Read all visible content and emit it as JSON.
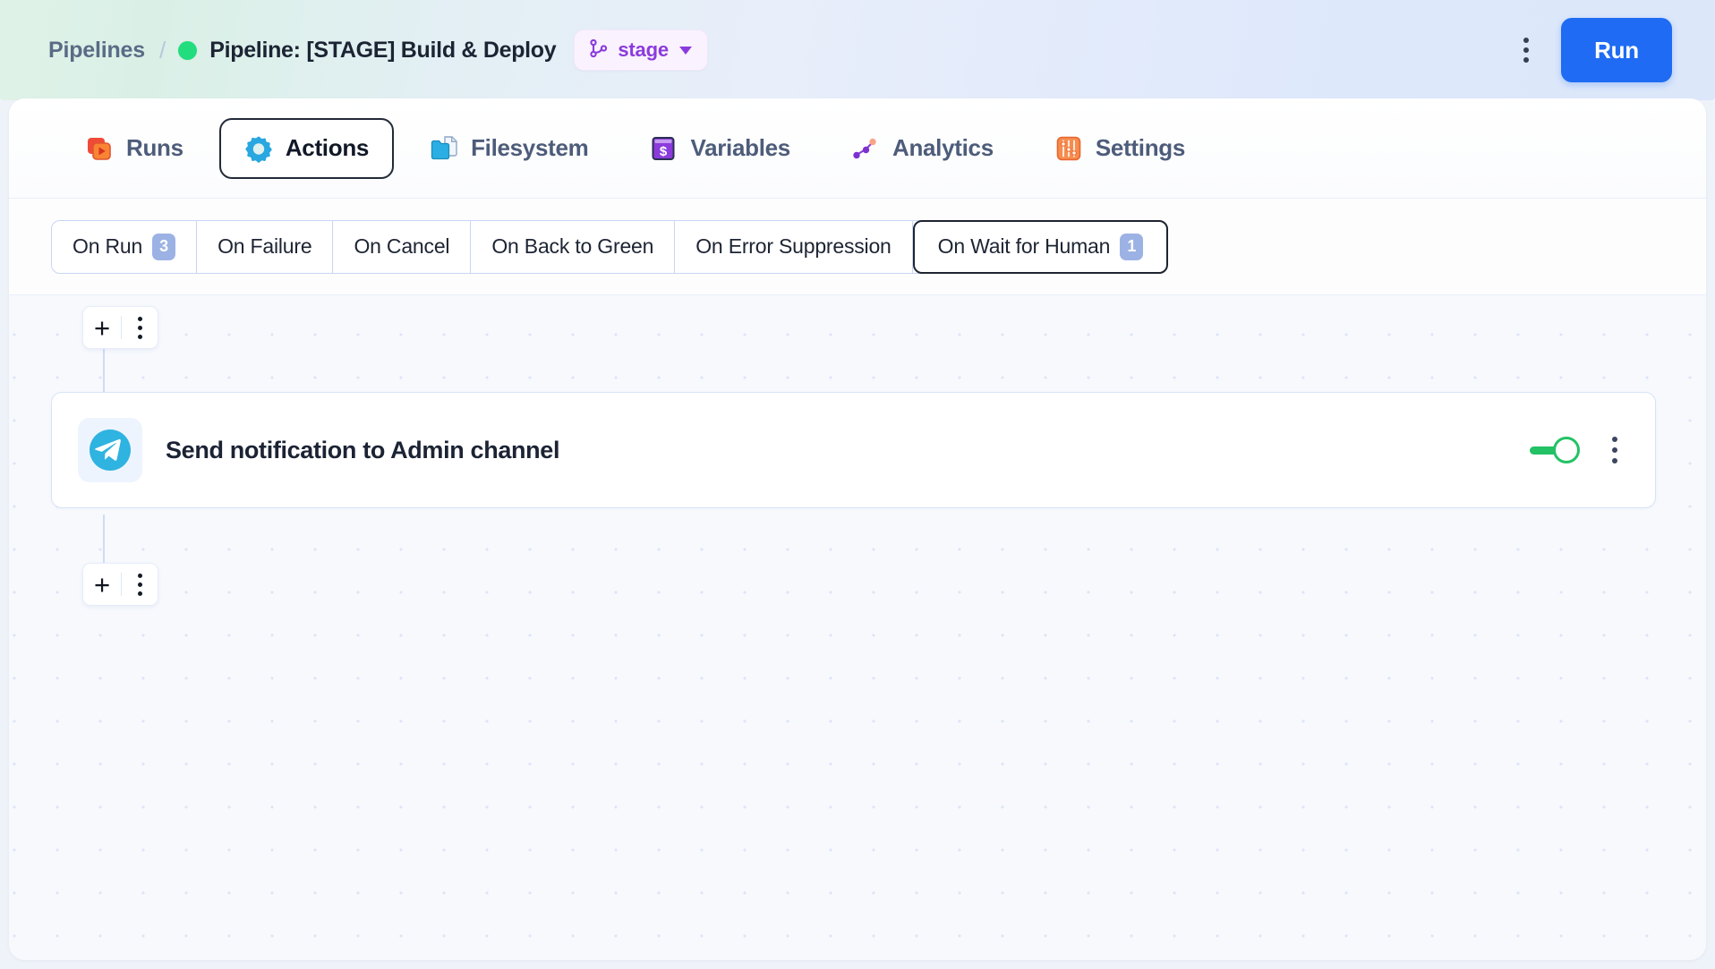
{
  "header": {
    "breadcrumb_root": "Pipelines",
    "breadcrumb_separator": "/",
    "pipeline_title": "Pipeline: [STAGE] Build & Deploy",
    "status_color": "#22dd7e",
    "branch_badge": {
      "label": "stage",
      "color": "#8b3bdc"
    },
    "run_button": "Run",
    "run_button_color": "#1f6bf3"
  },
  "nav_tabs": [
    {
      "label": "Runs",
      "icon": "runs-icon",
      "active": false
    },
    {
      "label": "Actions",
      "icon": "actions-icon",
      "active": true
    },
    {
      "label": "Filesystem",
      "icon": "filesystem-icon",
      "active": false
    },
    {
      "label": "Variables",
      "icon": "variables-icon",
      "active": false
    },
    {
      "label": "Analytics",
      "icon": "analytics-icon",
      "active": false
    },
    {
      "label": "Settings",
      "icon": "settings-icon",
      "active": false
    }
  ],
  "event_tabs": [
    {
      "label": "On Run",
      "count": "3",
      "selected": false
    },
    {
      "label": "On Failure",
      "count": "",
      "selected": false
    },
    {
      "label": "On Cancel",
      "count": "",
      "selected": false
    },
    {
      "label": "On Back to Green",
      "count": "",
      "selected": false
    },
    {
      "label": "On Error Suppression",
      "count": "",
      "selected": false
    },
    {
      "label": "On Wait for Human",
      "count": "1",
      "selected": true
    }
  ],
  "canvas": {
    "top_add_button": {
      "plus": "+",
      "menu": "kebab-icon"
    },
    "bottom_add_button": {
      "plus": "+",
      "menu": "kebab-icon"
    },
    "action_card": {
      "title": "Send notification to Admin channel",
      "icon": "telegram-icon",
      "enabled_toggle": true,
      "toggle_color": "#22c265",
      "menu": "kebab-icon"
    }
  }
}
